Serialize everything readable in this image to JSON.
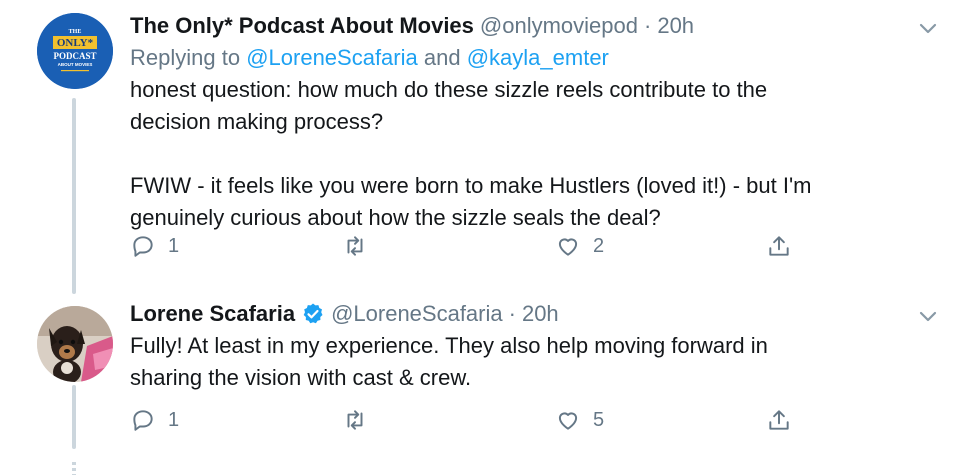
{
  "colors": {
    "accent": "#1da1f2",
    "secondary_text": "#657786",
    "primary_text": "#14171a",
    "thread_line": "#ccd6dd",
    "verified": "#1da1f2"
  },
  "tweets": [
    {
      "display_name": "The Only* Podcast About Movies",
      "handle": "@onlymoviepod",
      "separator": "·",
      "timestamp": "20h",
      "reply_prefix": "Replying to",
      "reply_mention_1": "@LoreneScafaria",
      "reply_and": "and",
      "reply_mention_2": "@kayla_emter",
      "text_lines": [
        "honest question: how much do these sizzle reels contribute to the",
        "decision making process?",
        "FWIW - it feels like you were born to make Hustlers (loved it!) - but I'm",
        "genuinely curious about how the sizzle seals the deal?"
      ],
      "avatar_logo": {
        "line1": "THE",
        "line2": "ONLY*",
        "line3": "PODCAST",
        "line4": "ABOUT MOVIES"
      },
      "reply_count": "1",
      "retweet_count": "",
      "like_count": "2",
      "icons": {
        "reply": "reply-icon",
        "retweet": "retweet-icon",
        "like": "heart-icon",
        "share": "share-icon",
        "menu": "chevron-down-icon"
      }
    },
    {
      "display_name": "Lorene Scafaria",
      "verified": true,
      "handle": "@LoreneScafaria",
      "separator": "·",
      "timestamp": "20h",
      "text_lines": [
        "Fully! At least in my experience. They also help moving forward in",
        "sharing the vision with cast & crew."
      ],
      "reply_count": "1",
      "retweet_count": "",
      "like_count": "5",
      "icons": {
        "reply": "reply-icon",
        "retweet": "retweet-icon",
        "like": "heart-icon",
        "share": "share-icon",
        "menu": "chevron-down-icon",
        "verified": "verified-badge-icon"
      }
    }
  ]
}
